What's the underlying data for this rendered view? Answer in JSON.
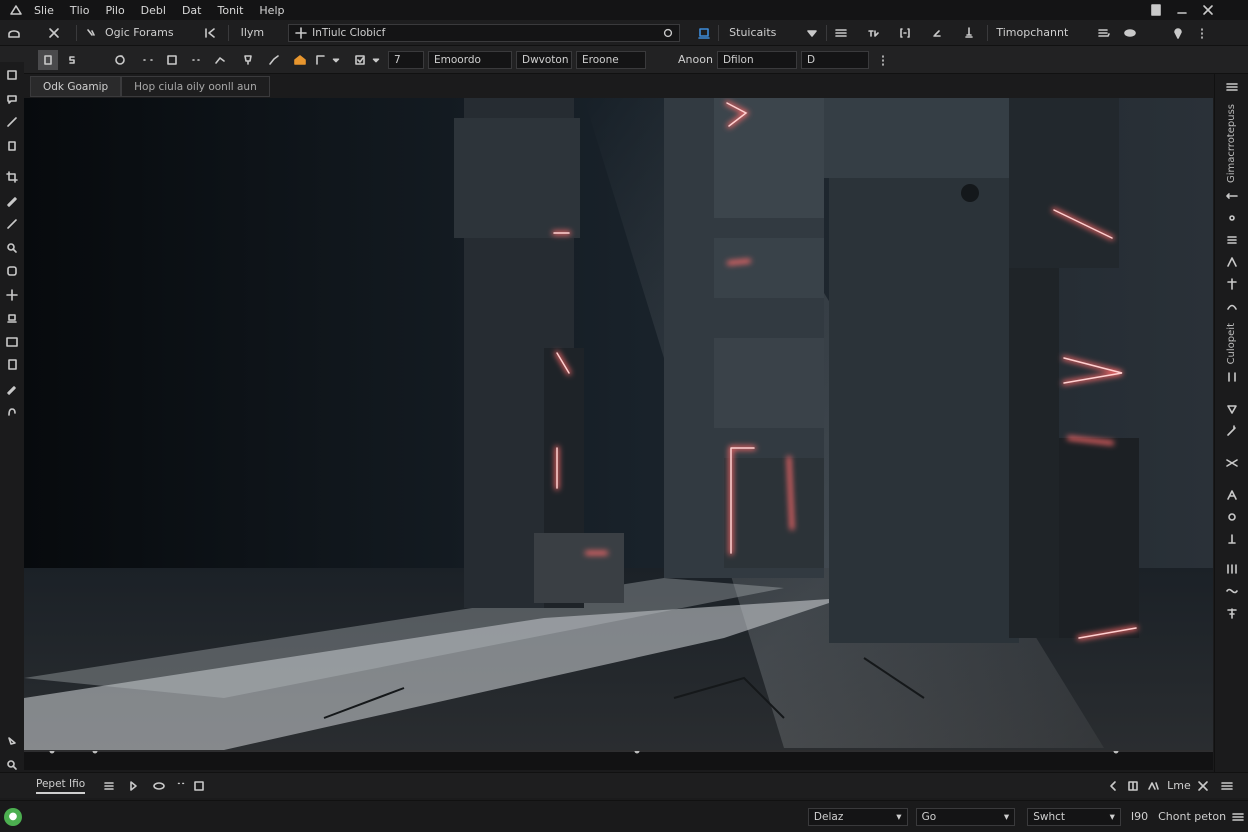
{
  "menubar": {
    "items": [
      "Slie",
      "Tlio",
      "Pilo",
      "Debl",
      "Dat",
      "Tonit",
      "Help"
    ]
  },
  "toolbar1": {
    "preset_label": "Ogic Forams",
    "mode_label": "Ilym",
    "search_value": "InTiulc Clobicf",
    "setting_label": "Stuicaits",
    "menu_label": "Timopchannt"
  },
  "toolbar2": {
    "num_value": "7",
    "field1": "Emoordo",
    "field2": "Dwvoton",
    "field3": "Eroone",
    "anon_label": "Anoon",
    "field4": "Dfilon",
    "field5": "D"
  },
  "tabs": {
    "tab1": "Odk Goamip",
    "tab2": "Hop ciula oily oonll aun"
  },
  "rightbar": {
    "vtext1": "Gimacrrotepuss",
    "vtext2": "Culopeit"
  },
  "bottombar": {
    "tab_label": "Pepet Ifio",
    "right_label": "Lme"
  },
  "statusbar": {
    "dropdown1": "Delaz",
    "dropdown2": "Go",
    "dropdown3": "Swhct",
    "count": "I90",
    "right_label": "Chont peton"
  },
  "colors": {
    "background": "#1b1b1c",
    "accent_orange": "#e8962e",
    "accent_blue": "#3d8bd9",
    "status_green": "#4caf50",
    "glow_red": "#ff5a5a"
  },
  "icons": [
    "pyramid",
    "x",
    "plus",
    "download",
    "more",
    "users",
    "gallery",
    "minimize",
    "close",
    "home"
  ]
}
